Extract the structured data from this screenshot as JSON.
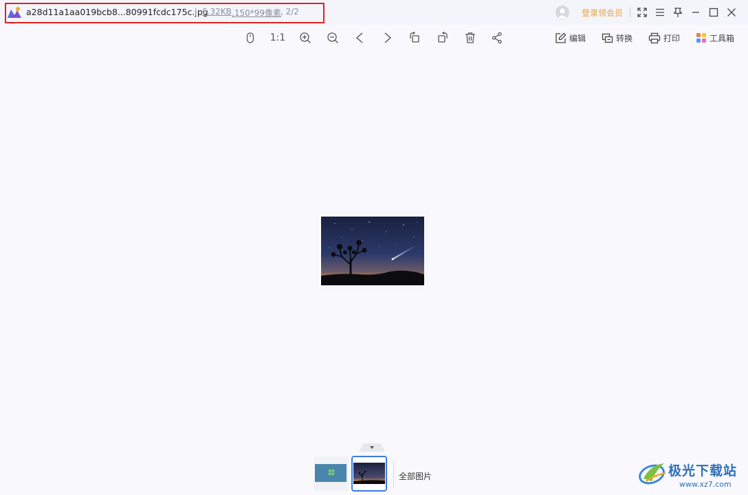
{
  "titlebar": {
    "file_name": "a28d11a1aa019bcb8...80991fcdc175c.jpg",
    "file_size": "6.32KB",
    "dimensions": ",150*99像素",
    "index": ", 2/2",
    "vip_link": "登录领会员"
  },
  "toolbar": {
    "actual_size_label": "1:1",
    "edit_label": "编辑",
    "convert_label": "转换",
    "print_label": "打印",
    "toolbox_label": "工具箱"
  },
  "filmstrip": {
    "all_images_label": "全部图片"
  },
  "watermark": {
    "text": "极光下载站",
    "url": "www.xz7.com"
  },
  "colors": {
    "accent": "#3a7bea",
    "vip": "#e8a23c",
    "highlight": "#e02020",
    "background": "#f9f9fd"
  },
  "icons": [
    "app-logo-icon",
    "user-icon",
    "fullscreen-icon",
    "menu-icon",
    "pin-icon",
    "minimize-icon",
    "maximize-icon",
    "close-icon",
    "mouse-icon",
    "zoom-in-icon",
    "zoom-out-icon",
    "prev-icon",
    "next-icon",
    "rotate-left-icon",
    "rotate-right-icon",
    "delete-icon",
    "share-icon",
    "edit-icon",
    "convert-icon",
    "print-icon",
    "toolbox-icon"
  ]
}
